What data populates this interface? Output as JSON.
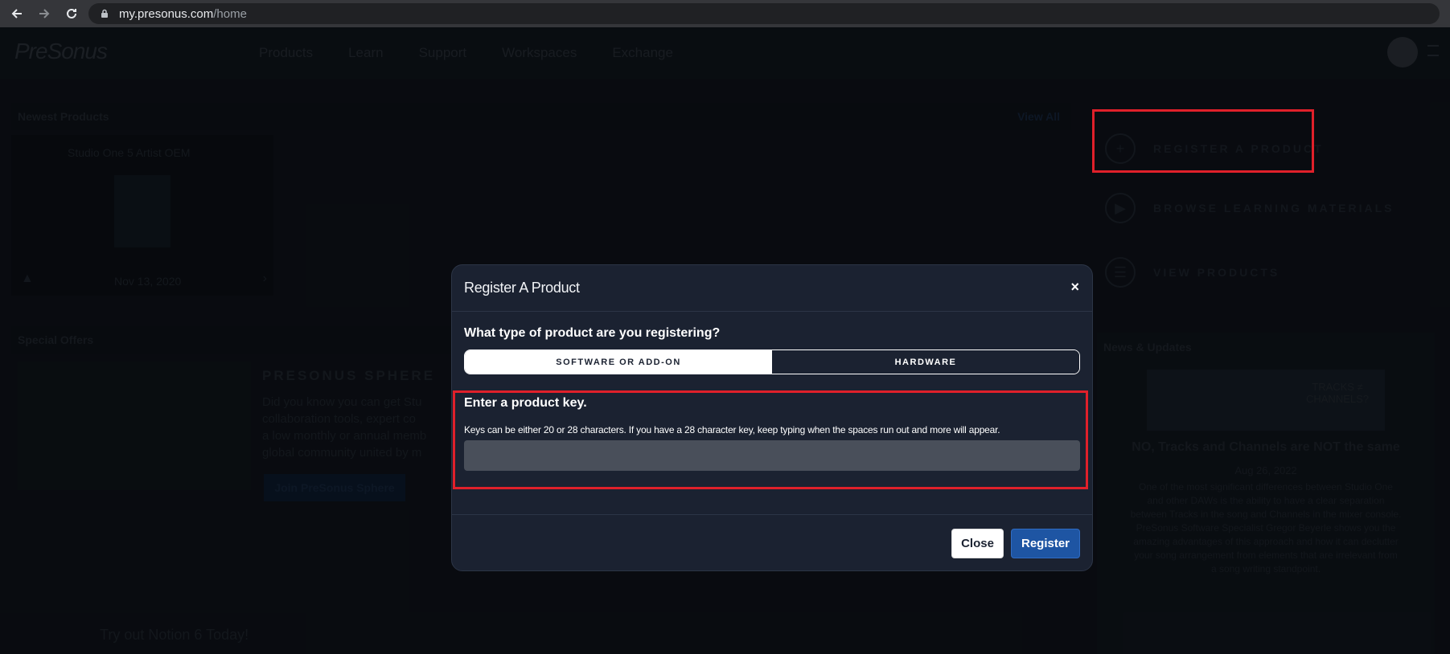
{
  "browser": {
    "url_domain": "my.presonus.com",
    "url_path": "/home"
  },
  "site": {
    "logo_text": "PreSonus",
    "nav": [
      "Products",
      "Learn",
      "Support",
      "Workspaces",
      "Exchange"
    ],
    "newest_products_title": "Newest Products",
    "view_all": "View All",
    "product_card": {
      "name": "Studio One 5 Artist OEM",
      "date": "Nov 13, 2020"
    },
    "special_offers_title": "Special Offers",
    "sphere_title": "PRESONUS SPHERE",
    "sphere_body": [
      "Did you know you can get Stu",
      "collaboration tools, expert co",
      "a low monthly or annual memb",
      "global community united by m"
    ],
    "sphere_button": "Join PreSonus Sphere",
    "notion_promo": "Try out Notion 6 Today!",
    "register_items": [
      {
        "icon": "+",
        "label": "REGISTER A PRODUCT"
      },
      {
        "icon": "▶",
        "label": "BROWSE LEARNING MATERIALS"
      },
      {
        "icon": "☰",
        "label": "VIEW PRODUCTS"
      }
    ],
    "news_title": "News & Updates",
    "news_thumb_text": "TRACKS ≠ CHANNELS?",
    "news_headline": "NO, Tracks and Channels are NOT the same",
    "news_date": "Aug 26, 2022",
    "news_body": [
      "One of the most significant differences between Studio One",
      "and other DAWs is the ability to have a clear separation",
      "between Tracks in the song and Channels in the mixer console.",
      "PreSonus Software Specialist Gregor Beyerle shows you the",
      "amazing advantages of this approach and how it can declutter",
      "your song arrangement from elements that are irrelevant from",
      "a song writing standpoint."
    ]
  },
  "modal": {
    "title": "Register A Product",
    "close_symbol": "×",
    "question": "What type of product are you registering?",
    "options": [
      "SOFTWARE OR ADD-ON",
      "HARDWARE"
    ],
    "selected_option": "SOFTWARE OR ADD-ON",
    "key_title": "Enter a product key.",
    "key_help": "Keys can be either 20 or 28 characters. If you have a 28 character key, keep typing when the spaces run out and more will appear.",
    "key_value": "",
    "close_button": "Close",
    "register_button": "Register"
  },
  "colors": {
    "modal_bg": "#1b2231",
    "register_blue": "#1e55a3",
    "highlight_red": "#e0202a"
  }
}
